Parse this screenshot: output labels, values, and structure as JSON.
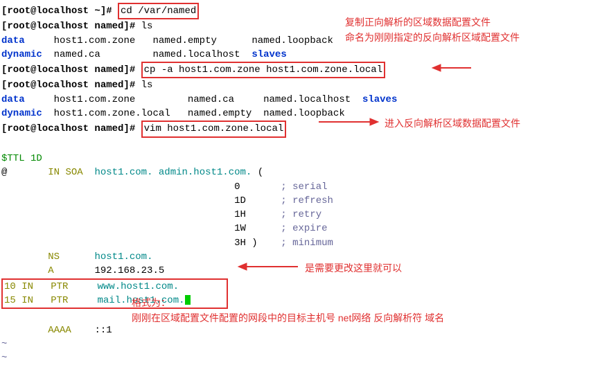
{
  "prompts": {
    "home": "[root@localhost ~]# ",
    "named": "[root@localhost named]# "
  },
  "cmds": {
    "cd": "cd /var/named",
    "ls1": "ls",
    "cp": "cp -a host1.com.zone host1.com.zone.local",
    "ls2": "ls",
    "vim": "vim host1.com.zone.local"
  },
  "ls1": {
    "c1a": "data",
    "c1b": "host1.com.zone",
    "c1c": "named.empty",
    "c1d": "named.loopback",
    "c2a": "dynamic",
    "c2b": "named.ca",
    "c2c": "named.localhost",
    "c2d": "slaves"
  },
  "ls2": {
    "c1a": "data",
    "c1b": "host1.com.zone",
    "c1c": "named.ca",
    "c1d": "named.localhost",
    "c1e": "slaves",
    "c2a": "dynamic",
    "c2b": "host1.com.zone.local",
    "c2c": "named.empty",
    "c2d": "named.loopback"
  },
  "zone": {
    "ttl": "$TTL 1D",
    "soa_at": "@",
    "soa_in": "IN",
    "soa_rr": "SOA",
    "soa_ns": "host1.com.",
    "soa_admin": "admin.host1.com.",
    "soa_open": "(",
    "serial_v": "0",
    "serial_c": "; serial",
    "refresh_v": "1D",
    "refresh_c": "; refresh",
    "retry_v": "1H",
    "retry_c": "; retry",
    "expire_v": "1W",
    "expire_c": "; expire",
    "minimum_v": "3H",
    "minimum_close": ")",
    "minimum_c": "; minimum",
    "ns_rr": "NS",
    "ns_v": "host1.com.",
    "a_rr": "A",
    "a_v": "192.168.23.5",
    "p1_n": "10",
    "p1_in": "IN",
    "p1_rr": "PTR",
    "p1_v": "www.host1.com.",
    "p2_n": "15",
    "p2_in": "IN",
    "p2_rr": "PTR",
    "p2_v": "mail.host1.com.",
    "aaaa_rr": "AAAA",
    "aaaa_v": "::1",
    "tilde": "~"
  },
  "annotations": {
    "a1": "复制正向解析的区域数据配置文件",
    "a2": "命名为刚刚指定的反向解析区域配置文件",
    "a3": "进入反向解析区域数据配置文件",
    "a4": "是需要更改这里就可以",
    "a5a": "格式为：",
    "a5b": "刚刚在区域配置文件配置的网段中的目标主机号  net网络 反向解析符  域名"
  }
}
